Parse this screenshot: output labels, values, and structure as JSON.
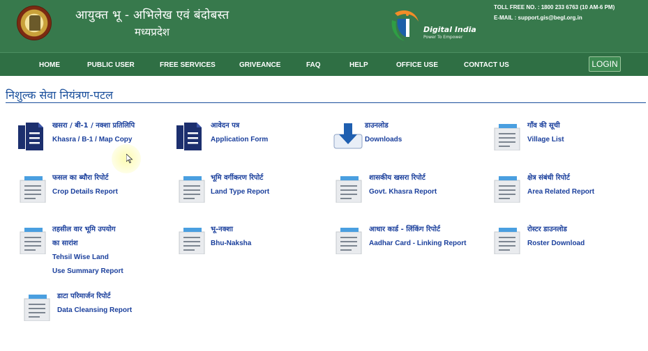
{
  "header": {
    "title_line1": "आयुक्त   भू - अभिलेख एवं बंदोबस्त",
    "title_line2": "मध्यप्रदेश",
    "digital_india": "Digital India",
    "digital_india_tagline": "Power To Empower",
    "toll_free": "TOLL FREE NO. : 1800 233 6763 (10 AM-6 PM)",
    "email": "E-MAIL : support.gis@begl.org.in"
  },
  "nav": {
    "items": [
      "HOME",
      "PUBLIC USER",
      "FREE SERVICES",
      "GRIVEANCE",
      "FAQ",
      "HELP",
      "OFFICE USE",
      "CONTACT US"
    ],
    "login": "LOGIN"
  },
  "section": {
    "title": "निशुल्क सेवा नियंत्रण-पटल"
  },
  "services": [
    {
      "hi": "खसरा / बी-1 / नक्शा प्रतिलिपि",
      "en": "Khasra / B-1 / Map Copy",
      "icon": "document-copy-icon"
    },
    {
      "hi": "आवेदन पत्र",
      "en": "Application Form",
      "icon": "document-copy-icon"
    },
    {
      "hi": "डाउनलोड",
      "en": "Downloads",
      "icon": "download-icon"
    },
    {
      "hi": "गाँव की सूची",
      "en": "Village List",
      "icon": "report-icon"
    },
    {
      "hi": "फसल का ब्यौरा रिपोर्ट",
      "en": "Crop Details Report",
      "icon": "report-icon"
    },
    {
      "hi": "भूमि वर्गीकरण रिपोर्ट",
      "en": "Land Type Report",
      "icon": "report-icon"
    },
    {
      "hi": "शासकीय खसरा रिपोर्ट",
      "en": "Govt. Khasra Report",
      "icon": "report-icon"
    },
    {
      "hi": "क्षेत्र संबंधी रिपोर्ट",
      "en": "Area Related Report",
      "icon": "report-icon"
    },
    {
      "hi": "तहसील वार भूमि उपयोग",
      "hi2": "का सारांश",
      "en": "Tehsil Wise Land",
      "en2": "Use Summary Report",
      "icon": "report-icon"
    },
    {
      "hi": "भू-नक्शा",
      "en": "Bhu-Naksha",
      "icon": "report-icon"
    },
    {
      "hi": "आधार कार्ड - लिंकिंग रिपोर्ट",
      "en": "Aadhar Card - Linking Report",
      "icon": "report-icon"
    },
    {
      "hi": "रोस्टर डाउनलोड",
      "en": "Roster Download",
      "icon": "report-icon"
    },
    {
      "hi": "डाटा परिमार्जन रिपोर्ट",
      "en": "Data Cleansing Report",
      "icon": "report-icon"
    }
  ]
}
